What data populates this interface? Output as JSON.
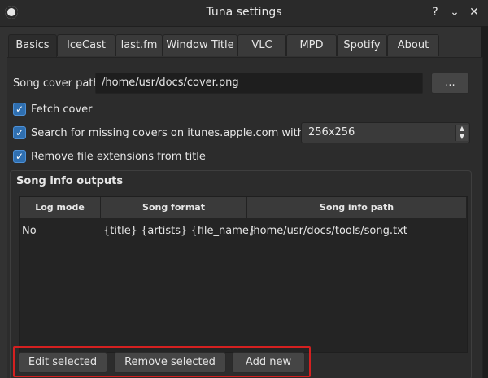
{
  "window": {
    "title": "Tuna settings",
    "app_icon": "obs-circle-icon",
    "buttons": {
      "help": "?",
      "minimize": "⌄",
      "close": "✕"
    }
  },
  "tabs": [
    {
      "label": "Basics",
      "active": true
    },
    {
      "label": "IceCast",
      "active": false
    },
    {
      "label": "last.fm",
      "active": false
    },
    {
      "label": "Window Title",
      "active": false
    },
    {
      "label": "VLC",
      "active": false
    },
    {
      "label": "MPD",
      "active": false
    },
    {
      "label": "Spotify",
      "active": false
    },
    {
      "label": "About",
      "active": false
    }
  ],
  "basics": {
    "song_cover_label": "Song cover path",
    "song_cover_value": "/home/usr/docs/cover.png",
    "browse_label": "...",
    "fetch_cover": {
      "label": "Fetch cover",
      "checked": true
    },
    "search_missing": {
      "label": "Search for missing covers on itunes.apple.com with size",
      "checked": true
    },
    "size_value": "256x256",
    "remove_ext": {
      "label": "Remove file extensions from title",
      "checked": true
    },
    "check_mark": "✓"
  },
  "outputs": {
    "group_title": "Song info outputs",
    "columns": [
      "Log mode",
      "Song format",
      "Song info path"
    ],
    "rows": [
      {
        "log_mode": "No",
        "format": "{title} {artists} {file_name}",
        "path": "/home/usr/docs/tools/song.txt"
      }
    ],
    "buttons": {
      "edit": "Edit selected",
      "remove": "Remove selected",
      "add": "Add new"
    }
  },
  "colors": {
    "accent": "#2f6fb0",
    "highlight_border": "#d42020"
  }
}
